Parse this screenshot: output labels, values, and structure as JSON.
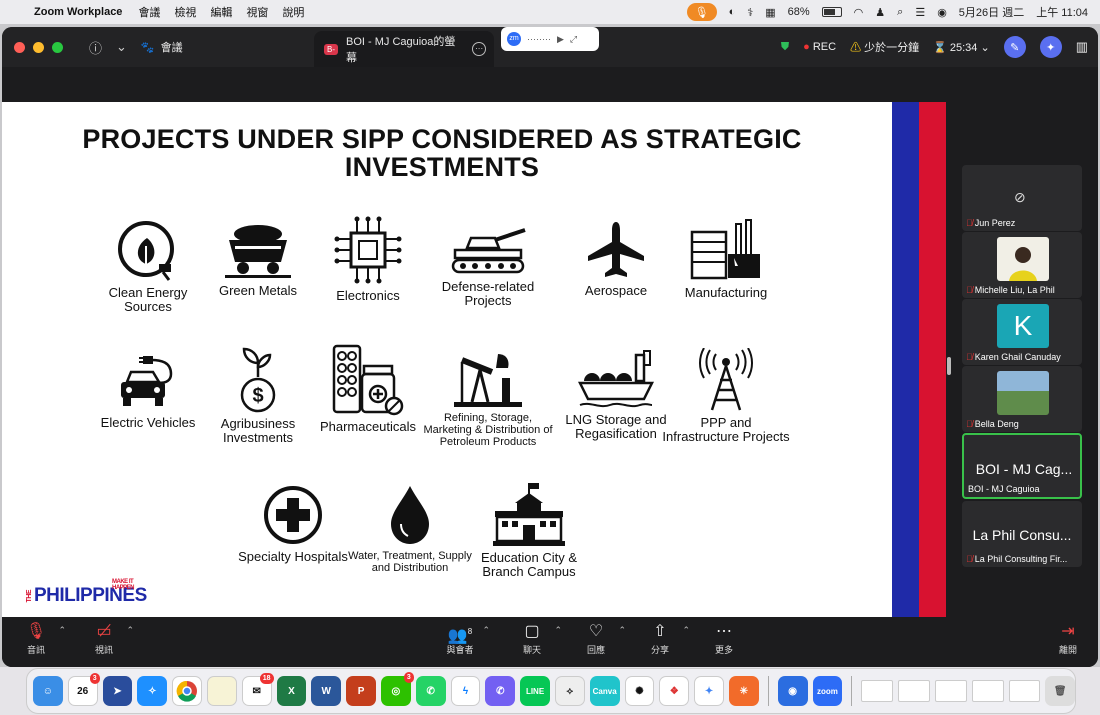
{
  "menubar": {
    "app_name": "Zoom Workplace",
    "items": [
      "會議",
      "檢視",
      "編輯",
      "視窗",
      "說明"
    ],
    "battery": "68%",
    "battery_level": 0.68,
    "date": "5月26日 週二",
    "time": "上午 11:04"
  },
  "titlebar": {
    "meeting_label": "會議",
    "share_tab_badge": "B-",
    "share_tab_title": "BOI - MJ Caguioa的螢幕",
    "float_badge": "zm",
    "rec_label": "REC",
    "warning_text": "少於一分鐘",
    "timer": "25:34"
  },
  "slide": {
    "title": "PROJECTS UNDER SIPP CONSIDERED AS STRATEGIC INVESTMENTS",
    "items": [
      {
        "label": "Clean Energy Sources",
        "icon": "leaf-plug-icon"
      },
      {
        "label": "Green Metals",
        "icon": "mine-cart-icon"
      },
      {
        "label": "Electronics",
        "icon": "chip-icon"
      },
      {
        "label": "Defense-related Projects",
        "icon": "tank-icon"
      },
      {
        "label": "Aerospace",
        "icon": "airplane-icon"
      },
      {
        "label": "Manufacturing",
        "icon": "factory-icon"
      },
      {
        "label": "Electric Vehicles",
        "icon": "ev-car-icon"
      },
      {
        "label": "Agribusiness Investments",
        "icon": "plant-coin-icon"
      },
      {
        "label": "Pharmaceuticals",
        "icon": "pills-icon"
      },
      {
        "label": "Refining, Storage, Marketing & Distribution of Petroleum Products",
        "icon": "oil-pump-icon"
      },
      {
        "label": "LNG Storage and Regasification",
        "icon": "lng-ship-icon"
      },
      {
        "label": "PPP and Infrastructure Projects",
        "icon": "tower-icon"
      },
      {
        "label": "Specialty Hospitals",
        "icon": "medical-cross-icon"
      },
      {
        "label": "Water, Treatment, Supply and Distribution",
        "icon": "water-drop-icon"
      },
      {
        "label": "Education City & Branch Campus",
        "icon": "school-icon"
      }
    ],
    "logo_the": "THE",
    "logo_text": "PHILIPPINES",
    "logo_tag": "MAKE IT HAPPEN"
  },
  "participants": [
    {
      "name": "Jun Perez"
    },
    {
      "name": "Michelle Liu, La Phil"
    },
    {
      "name": "Karen Ghail Canuday",
      "initial": "K"
    },
    {
      "name": "Bella Deng"
    },
    {
      "name": "BOI - MJ Caguioa",
      "display": "BOI - MJ Cag..."
    },
    {
      "name": "La Phil Consulting Fir...",
      "display": "La Phil Consu..."
    }
  ],
  "toolbar": {
    "audio": "音訊",
    "video": "視訊",
    "participants": "與會者",
    "participants_count": "8",
    "chat": "聊天",
    "react": "回應",
    "share": "分享",
    "more": "更多",
    "leave": "離開"
  },
  "dock": {
    "calendar_day": "26",
    "calendar_badge": "3",
    "mail_badge": "18",
    "wechat_badge": "3",
    "zoom_label": "zoom",
    "canva_label": "Canva"
  }
}
